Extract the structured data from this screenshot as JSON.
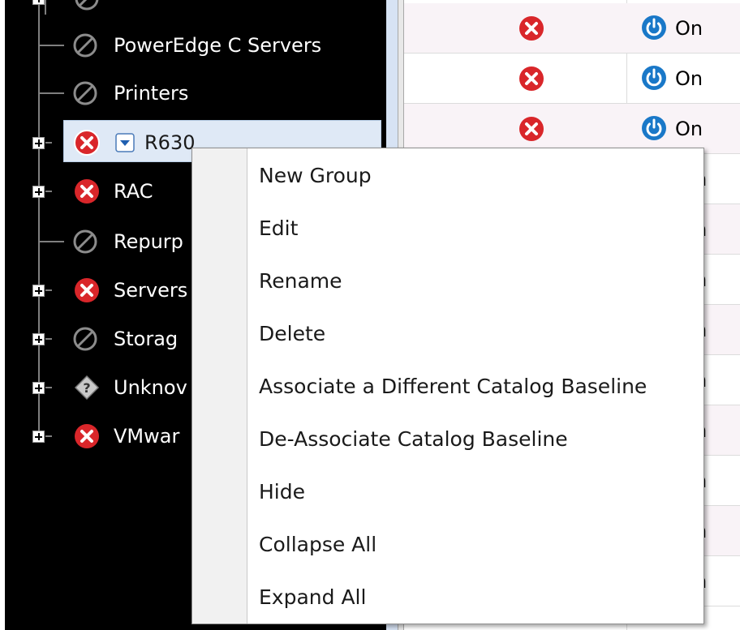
{
  "tree": {
    "items": [
      {
        "label": "",
        "status_icon": "disabled-icon",
        "expandable": true
      },
      {
        "label": "PowerEdge C Servers",
        "status_icon": "disabled-icon",
        "expandable": false
      },
      {
        "label": "Printers",
        "status_icon": "disabled-icon",
        "expandable": false
      },
      {
        "label": "R630",
        "status_icon": "error-icon",
        "expandable": true,
        "selected": true
      },
      {
        "label": "RAC",
        "status_icon": "error-icon",
        "expandable": true
      },
      {
        "label": "Repurp",
        "status_icon": "disabled-icon",
        "expandable": false
      },
      {
        "label": "Servers",
        "status_icon": "error-icon",
        "expandable": true
      },
      {
        "label": "Storag",
        "status_icon": "disabled-icon",
        "expandable": true
      },
      {
        "label": "Unknov",
        "status_icon": "unknown-icon",
        "expandable": true
      },
      {
        "label": "VMwar",
        "status_icon": "error-icon",
        "expandable": true
      }
    ]
  },
  "grid": {
    "rows": [
      {
        "status_icon": "error-icon",
        "power_state": "On"
      },
      {
        "status_icon": "error-icon",
        "power_state": "On"
      },
      {
        "status_icon": "error-icon",
        "power_state": "On"
      },
      {
        "partial": "n"
      },
      {
        "partial": "n"
      },
      {
        "partial": "n"
      },
      {
        "partial": "n"
      },
      {
        "partial": "n"
      },
      {
        "partial": "n"
      },
      {
        "partial": "n"
      },
      {
        "partial": "n"
      },
      {
        "partial": "n"
      },
      {
        "partial": "n"
      }
    ]
  },
  "context_menu": {
    "items": [
      "New Group",
      "Edit",
      "Rename",
      "Delete",
      "Associate a Different Catalog Baseline",
      "De-Associate Catalog Baseline",
      "Hide",
      "Collapse All",
      "Expand All"
    ]
  },
  "colors": {
    "tree_background": "#000000",
    "error_red": "#d9262a",
    "power_blue": "#1a78c8",
    "selection": "#dfe9f6"
  }
}
